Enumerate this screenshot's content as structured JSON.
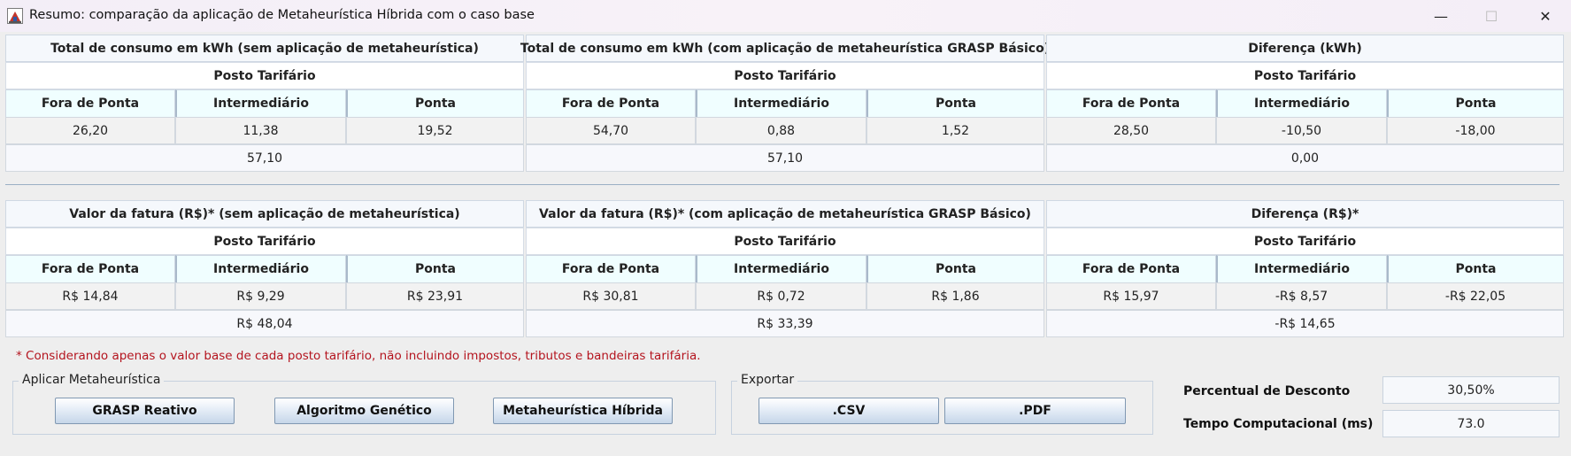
{
  "window": {
    "title": "Resumo: comparação da aplicação de Metaheurística Híbrida com o caso base",
    "minimize_glyph": "—",
    "maximize_glyph": "☐",
    "close_glyph": "✕"
  },
  "consumption": {
    "groups": [
      {
        "title": "Total de consumo em kWh (sem aplicação de metaheurística)",
        "subtitle": "Posto Tarifário",
        "columns": [
          "Fora de Ponta",
          "Intermediário",
          "Ponta"
        ],
        "values": [
          "26,20",
          "11,38",
          "19,52"
        ],
        "total": "57,10"
      },
      {
        "title": "Total de consumo em kWh (com aplicação de metaheurística GRASP Básico)",
        "subtitle": "Posto Tarifário",
        "columns": [
          "Fora de Ponta",
          "Intermediário",
          "Ponta"
        ],
        "values": [
          "54,70",
          "0,88",
          "1,52"
        ],
        "total": "57,10"
      },
      {
        "title": "Diferença (kWh)",
        "subtitle": "Posto Tarifário",
        "columns": [
          "Fora de Ponta",
          "Intermediário",
          "Ponta"
        ],
        "values": [
          "28,50",
          "-10,50",
          "-18,00"
        ],
        "total": "0,00"
      }
    ]
  },
  "invoice": {
    "groups": [
      {
        "title": "Valor da fatura (R$)* (sem aplicação de metaheurística)",
        "subtitle": "Posto Tarifário",
        "columns": [
          "Fora de Ponta",
          "Intermediário",
          "Ponta"
        ],
        "values": [
          "R$ 14,84",
          "R$ 9,29",
          "R$ 23,91"
        ],
        "total": "R$ 48,04"
      },
      {
        "title": "Valor da fatura (R$)* (com aplicação de metaheurística GRASP Básico)",
        "subtitle": "Posto Tarifário",
        "columns": [
          "Fora de Ponta",
          "Intermediário",
          "Ponta"
        ],
        "values": [
          "R$ 30,81",
          "R$ 0,72",
          "R$ 1,86"
        ],
        "total": "R$ 33,39"
      },
      {
        "title": "Diferença (R$)*",
        "subtitle": "Posto Tarifário",
        "columns": [
          "Fora de Ponta",
          "Intermediário",
          "Ponta"
        ],
        "values": [
          "R$ 15,97",
          "-R$ 8,57",
          "-R$ 22,05"
        ],
        "total": "-R$ 14,65"
      }
    ]
  },
  "note": "* Considerando apenas o valor base de cada posto tarifário, não incluindo impostos, tributos e bandeiras tarifária.",
  "apply": {
    "legend": "Aplicar Metaheurística",
    "buttons": [
      "GRASP Reativo",
      "Algoritmo Genético",
      "Metaheurística Híbrida"
    ]
  },
  "export": {
    "legend": "Exportar",
    "buttons": [
      ".CSV",
      ".PDF"
    ]
  },
  "stats": {
    "discount_label": "Percentual de Desconto",
    "discount_value": "30,50%",
    "time_label": "Tempo Computacional (ms)",
    "time_value": "73.0"
  }
}
